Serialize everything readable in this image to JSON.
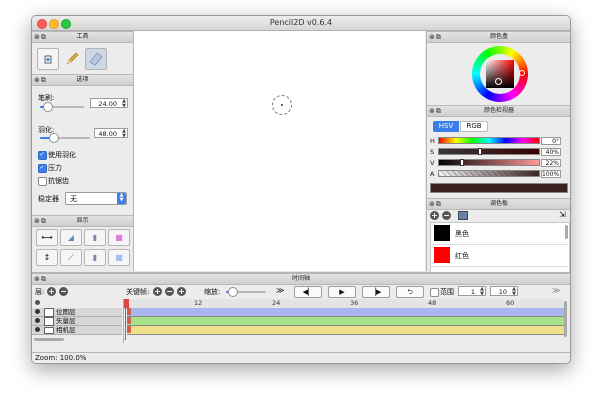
{
  "window": {
    "title": "Pencil2D v0.6.4"
  },
  "tools_panel": {
    "title": "工具",
    "tools": [
      {
        "icon": "bucket-icon"
      },
      {
        "icon": "pencil-icon"
      },
      {
        "icon": "eraser-icon"
      }
    ]
  },
  "options_panel": {
    "title": "选项",
    "brush_label": "笔刷:",
    "brush_value": "24.00",
    "brush_level": 0.15,
    "feather_label": "羽化:",
    "feather_value": "48.00",
    "feather_level": 0.25,
    "use_feather_label": "使用羽化",
    "use_feather_checked": true,
    "pressure_label": "压力",
    "pressure_checked": true,
    "antialias_label": "抗锯齿",
    "antialias_checked": false,
    "stabilizer_label": "稳定器",
    "stabilizer_value": "无"
  },
  "display_panel": {
    "title": "显示"
  },
  "color_box_panel": {
    "title": "颜色盒"
  },
  "color_inspector": {
    "title": "颜色检视器",
    "tabs": [
      "HSV",
      "RGB"
    ],
    "active_tab": "HSV",
    "channels": [
      {
        "label": "H",
        "value": "0°"
      },
      {
        "label": "S",
        "value": "40%"
      },
      {
        "label": "V",
        "value": "22%"
      },
      {
        "label": "A",
        "value": "100%"
      }
    ],
    "current_color": "#3a2222"
  },
  "palette_panel": {
    "title": "调色板",
    "swatches": [
      {
        "name": "黑色",
        "color": "#000000"
      },
      {
        "name": "红色",
        "color": "#ff0000"
      }
    ]
  },
  "timeline": {
    "title": "时间轴",
    "layers_label": "层:",
    "keyframe_label": "关键帧:",
    "zoom_label": "缩放:",
    "range_label": "范围",
    "range_from": "1",
    "range_to": "10",
    "frame_marks": [
      "12",
      "24",
      "36",
      "48",
      "60"
    ],
    "layers": [
      {
        "name": "位图层",
        "color": "#a9b7ee"
      },
      {
        "name": "矢量层",
        "color": "#a6e28a"
      },
      {
        "name": "相机层",
        "color": "#efe08a"
      }
    ]
  },
  "status": {
    "zoom_text": "Zoom: 100.0%"
  }
}
